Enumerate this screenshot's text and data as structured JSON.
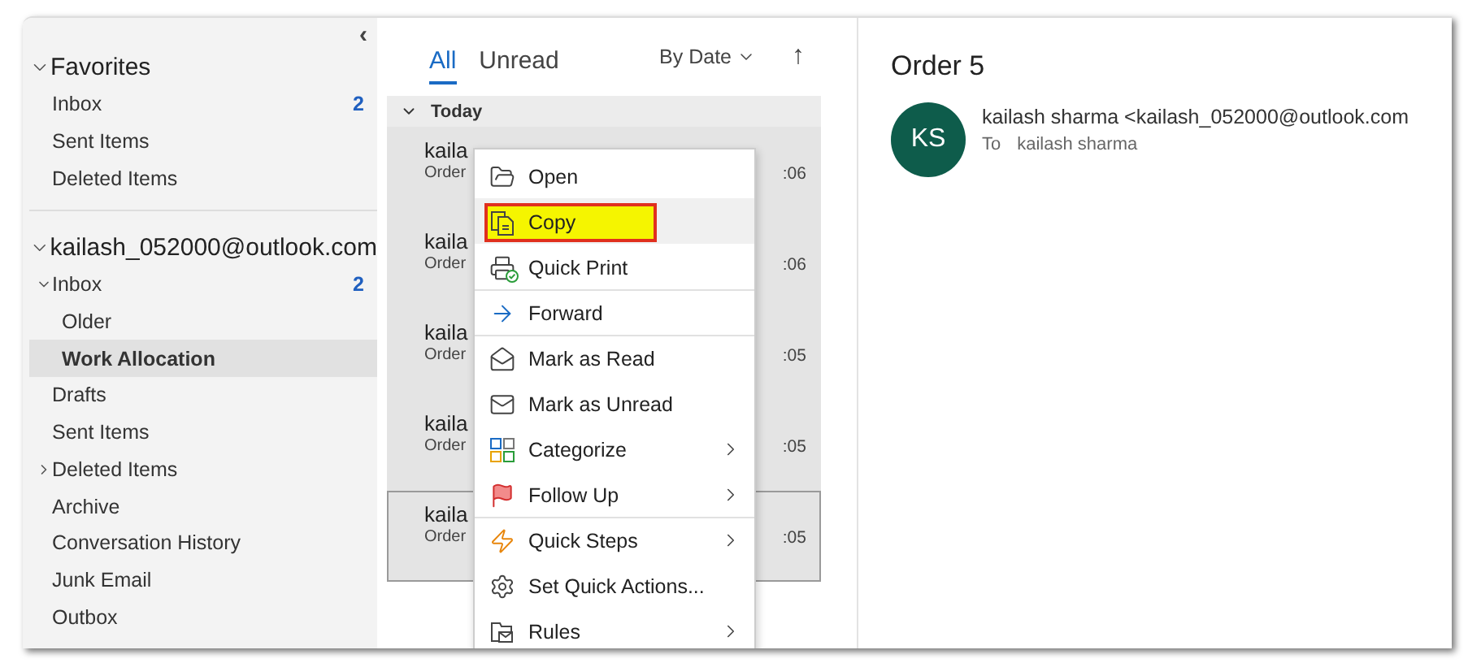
{
  "sidebar": {
    "collapse_icon": "‹",
    "sections": [
      {
        "title": "Favorites",
        "expanded": true,
        "items": [
          {
            "label": "Inbox",
            "count": "2",
            "selected": false
          },
          {
            "label": "Sent Items",
            "selected": false
          },
          {
            "label": "Deleted Items",
            "selected": false
          }
        ]
      },
      {
        "title": "kailash_052000@outlook.com",
        "expanded": true,
        "items": [
          {
            "label": "Inbox",
            "count": "2",
            "selected": false,
            "expanded": true,
            "children": [
              {
                "label": "Older",
                "selected": false
              },
              {
                "label": "Work Allocation",
                "selected": true
              }
            ]
          },
          {
            "label": "Drafts",
            "selected": false
          },
          {
            "label": "Sent Items",
            "selected": false
          },
          {
            "label": "Deleted Items",
            "selected": false,
            "expanded": false
          },
          {
            "label": "Archive",
            "selected": false
          },
          {
            "label": "Conversation History",
            "selected": false
          },
          {
            "label": "Junk Email",
            "selected": false
          },
          {
            "label": "Outbox",
            "selected": false
          }
        ]
      }
    ]
  },
  "mail_list": {
    "tabs": [
      {
        "label": "All",
        "selected": true
      },
      {
        "label": "Unread",
        "selected": false
      }
    ],
    "sort": "By Date",
    "sort_direction_icon": "↑",
    "group": {
      "label": "Today",
      "expanded": true
    },
    "messages": [
      {
        "sender": "kaila",
        "subject": "Order",
        "time": ":06",
        "selected": true,
        "focused": false
      },
      {
        "sender": "kaila",
        "subject": "Order",
        "time": ":06",
        "selected": true,
        "focused": false
      },
      {
        "sender": "kaila",
        "subject": "Order",
        "time": ":05",
        "selected": true,
        "focused": false
      },
      {
        "sender": "kaila",
        "subject": "Order",
        "time": ":05",
        "selected": true,
        "focused": false
      },
      {
        "sender": "kaila",
        "subject": "Order",
        "time": ":05",
        "selected": true,
        "focused": true
      }
    ]
  },
  "context_menu": {
    "items": [
      {
        "label": "Open",
        "kind": "open",
        "submenu": false,
        "selected": false,
        "annotated": false,
        "separator_before": false
      },
      {
        "label": "Copy",
        "kind": "copy",
        "submenu": false,
        "selected": true,
        "annotated": true,
        "separator_before": false
      },
      {
        "label": "Quick Print",
        "kind": "print",
        "submenu": false,
        "selected": false,
        "annotated": false,
        "separator_before": false
      },
      {
        "label": "Forward",
        "kind": "forward",
        "submenu": false,
        "selected": false,
        "annotated": false,
        "separator_before": true
      },
      {
        "label": "Mark as Read",
        "kind": "read",
        "submenu": false,
        "selected": false,
        "annotated": false,
        "separator_before": true
      },
      {
        "label": "Mark as Unread",
        "kind": "unread",
        "submenu": false,
        "selected": false,
        "annotated": false,
        "separator_before": false
      },
      {
        "label": "Categorize",
        "kind": "categorize",
        "submenu": true,
        "selected": false,
        "annotated": false,
        "separator_before": false
      },
      {
        "label": "Follow Up",
        "kind": "flag",
        "submenu": true,
        "selected": false,
        "annotated": false,
        "separator_before": false
      },
      {
        "label": "Quick Steps",
        "kind": "steps",
        "submenu": true,
        "selected": false,
        "annotated": false,
        "separator_before": true
      },
      {
        "label": "Set Quick Actions...",
        "kind": "gear",
        "submenu": false,
        "selected": false,
        "annotated": false,
        "separator_before": false
      },
      {
        "label": "Rules",
        "kind": "rules",
        "submenu": true,
        "selected": false,
        "annotated": false,
        "separator_before": false
      }
    ]
  },
  "reading_pane": {
    "subject": "Order 5",
    "avatar_initials": "KS",
    "sender": "kailash sharma <kailash_052000@outlook.com",
    "to_label": "To",
    "recipient": "kailash sharma"
  }
}
